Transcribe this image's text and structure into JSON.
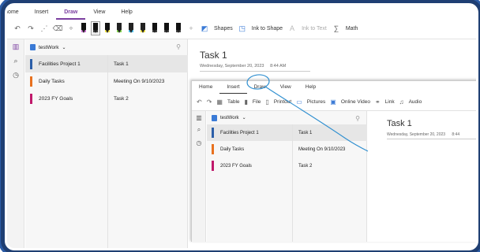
{
  "menu": {
    "items": [
      "Home",
      "Insert",
      "Draw",
      "View",
      "Help"
    ],
    "active": "Draw"
  },
  "toolbar": {
    "shapes_label": "Shapes",
    "ink_to_shape_label": "Ink to Shape",
    "ink_to_text_label": "Ink to Text",
    "math_label": "Math"
  },
  "notebook": {
    "name": "testWork",
    "sections": [
      {
        "label": "Facilities Project 1",
        "color": "#2b5ea8"
      },
      {
        "label": "Daily Tasks",
        "color": "#e8711f"
      },
      {
        "label": "2023 FY Goals",
        "color": "#c0196b"
      }
    ],
    "pages": [
      "Task 1",
      "Meeting On 9/10/2023",
      "Task 2"
    ]
  },
  "page": {
    "title": "Task 1",
    "date": "Wednesday, September 20, 2023",
    "time": "8:44 AM"
  },
  "inset": {
    "menu": [
      "Home",
      "Insert",
      "Draw",
      "View",
      "Help"
    ],
    "toolbar": {
      "table_label": "Table",
      "file_label": "File",
      "printout_label": "Printout",
      "pictures_label": "Pictures",
      "online_video_label": "Online Video",
      "link_label": "Link",
      "audio_label": "Audio"
    },
    "notebook_name": "testWork",
    "sections": [
      "Facilities Project 1",
      "Daily Tasks",
      "2023 FY Goals"
    ],
    "pages": [
      "Task 1",
      "Meeting On 9/10/2023",
      "Task 2"
    ],
    "page_title": "Task 1",
    "page_date": "Wednesday, September 20, 2023",
    "page_time": "8:44"
  },
  "colors": {
    "accent": "#7b3fa0",
    "annotation": "#2f8fd0",
    "frame": "#1f3f73"
  }
}
